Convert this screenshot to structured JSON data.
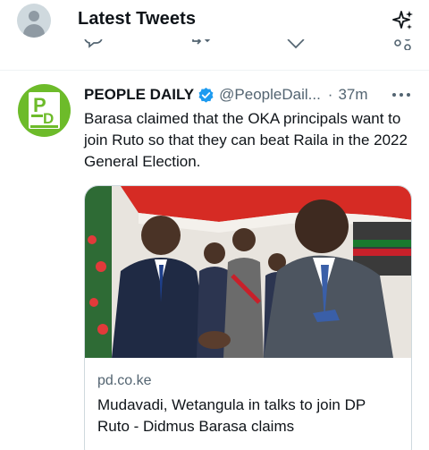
{
  "header": {
    "title": "Latest Tweets",
    "avatar_icon": "default-avatar-icon",
    "sparkle_icon": "sparkle-icon"
  },
  "tweet": {
    "author_name": "PEOPLE DAILY",
    "avatar_text": "PD",
    "avatar_subtext": "People Daily",
    "avatar_color": "#6dbb2a",
    "verified_icon": "verified-badge-icon",
    "verified_color": "#1d9bf0",
    "handle": "@PeopleDail...",
    "separator": "·",
    "time": "37m",
    "more_icon": "more-icon",
    "text": "Barasa claimed that the OKA principals want to join Ruto so that they can beat Raila in the 2022 General Election.",
    "card": {
      "domain": "pd.co.ke",
      "title": "Mudavadi, Wetangula in talks to join DP Ruto - Didmus Barasa claims",
      "image": "photo-of-politicians-shaking-hands"
    }
  },
  "colors": {
    "text": "#0f1419",
    "secondary_text": "#536471",
    "divider": "#eff3f4",
    "card_border": "#cfd9de"
  }
}
